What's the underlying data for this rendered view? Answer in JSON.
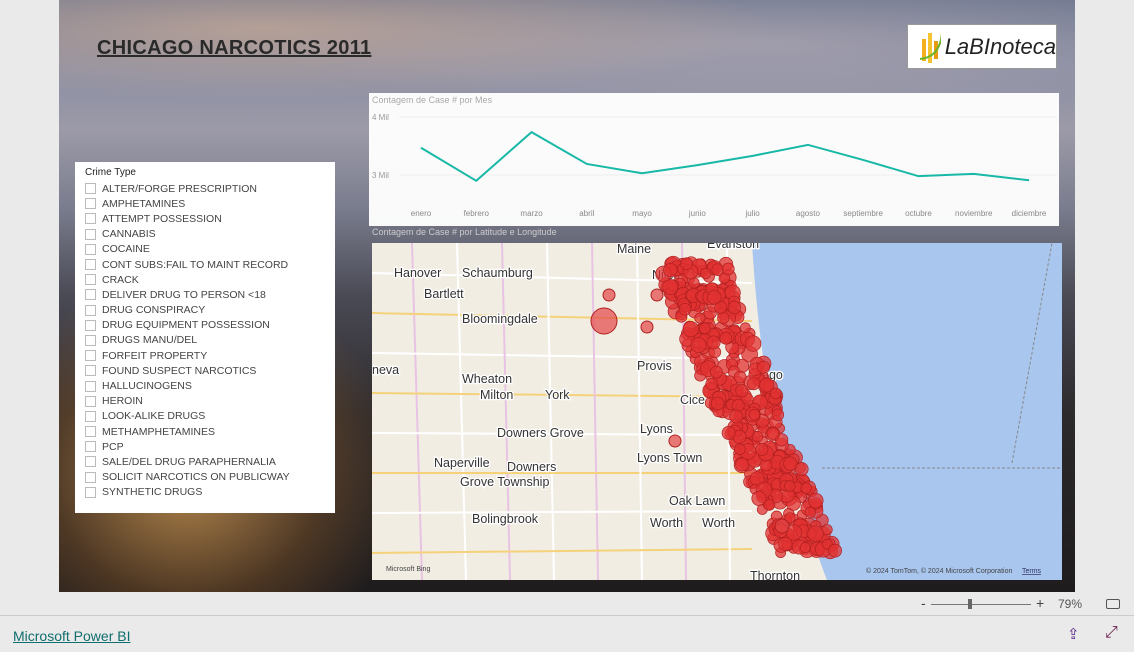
{
  "report": {
    "title": "CHICAGO NARCOTICS 2011",
    "logo_text": "LaBInoteca"
  },
  "slicer": {
    "header": "Crime Type",
    "items": [
      "ALTER/FORGE PRESCRIPTION",
      "AMPHETAMINES",
      "ATTEMPT POSSESSION",
      "CANNABIS",
      "COCAINE",
      "CONT SUBS:FAIL TO MAINT RECORD",
      "CRACK",
      "DELIVER DRUG TO PERSON <18",
      "DRUG CONSPIRACY",
      "DRUG EQUIPMENT POSSESSION",
      "DRUGS MANU/DEL",
      "FORFEIT PROPERTY",
      "FOUND SUSPECT NARCOTICS",
      "HALLUCINOGENS",
      "HEROIN",
      "LOOK-ALIKE DRUGS",
      "METHAMPHETAMINES",
      "PCP",
      "SALE/DEL DRUG PARAPHERNALIA",
      "SOLICIT NARCOTICS ON PUBLICWAY",
      "SYNTHETIC DRUGS"
    ]
  },
  "chart_data": {
    "type": "line",
    "title": "Contagem de Case # por Mes",
    "categories": [
      "enero",
      "febrero",
      "marzo",
      "abril",
      "mayo",
      "junio",
      "julio",
      "agosto",
      "septiembre",
      "octubre",
      "noviembre",
      "diciembre"
    ],
    "values": [
      3470,
      2900,
      3740,
      3190,
      3030,
      3170,
      3330,
      3520,
      3260,
      2980,
      3020,
      2910
    ],
    "ylim": [
      2600,
      4150
    ],
    "yticks": [
      {
        "v": 4000,
        "label": "4 Mil"
      },
      {
        "v": 3000,
        "label": "3 Mil"
      }
    ],
    "color": "#17b8a6",
    "grid": true
  },
  "map": {
    "title": "Contagem de Case # por Latitude e Longitude",
    "labels": [
      "Hanover",
      "Schaumburg",
      "Niles",
      "Bartlett",
      "Bloomingdale",
      "Wheaton",
      "Milton",
      "York",
      "Provis",
      "Cice",
      "Downers Grove",
      "Lyons",
      "Naperville",
      "Downers",
      "Grove Township",
      "Lyons Town",
      "Oak Lawn",
      "Bolingbrook",
      "Worth",
      "Worth",
      "Thornton",
      "Maine",
      "Evanston",
      "neva",
      "ago"
    ],
    "attribution": "© 2024 TomTom, © 2024 Microsoft Corporation",
    "terms": "Terms",
    "bing": "Microsoft Bing",
    "point_color": "#e03030"
  },
  "zoom": {
    "minus": "-",
    "plus": "+",
    "level": "79%"
  },
  "footer": {
    "brand": "Microsoft Power BI"
  }
}
